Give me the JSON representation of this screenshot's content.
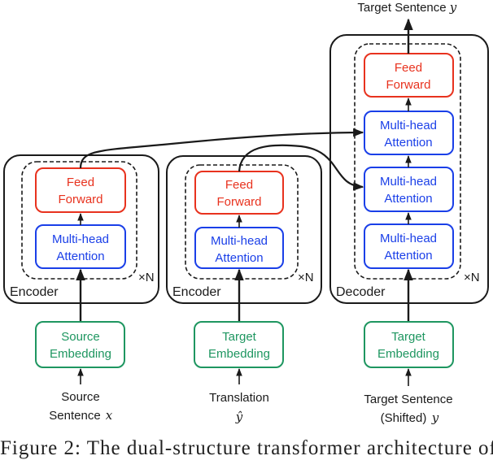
{
  "colors": {
    "feed_forward": "#e8321e",
    "attention": "#1a3fe8",
    "embedding": "#1e9660",
    "line": "#1a1a1a"
  },
  "top_output": {
    "text": "Target Sentence",
    "var": "y"
  },
  "repeat_label": "×N",
  "encoder1": {
    "title": "Encoder",
    "feed_forward": [
      "Feed",
      "Forward"
    ],
    "attention": [
      "Multi-head",
      "Attention"
    ],
    "embedding": [
      "Source",
      "Embedding"
    ],
    "input": [
      "Source",
      "Sentence"
    ],
    "input_var": "x"
  },
  "encoder2": {
    "title": "Encoder",
    "feed_forward": [
      "Feed",
      "Forward"
    ],
    "attention": [
      "Multi-head",
      "Attention"
    ],
    "embedding": [
      "Target",
      "Embedding"
    ],
    "input": [
      "Translation"
    ],
    "input_var": "ŷ"
  },
  "decoder": {
    "title": "Decoder",
    "feed_forward": [
      "Feed",
      "Forward"
    ],
    "attention_1": [
      "Multi-head",
      "Attention"
    ],
    "attention_2": [
      "Multi-head",
      "Attention"
    ],
    "attention_3": [
      "Multi-head",
      "Attention"
    ],
    "embedding": [
      "Target",
      "Embedding"
    ],
    "input": [
      "Target Sentence",
      "(Shifted)"
    ],
    "input_var": "y"
  },
  "caption": "Figure 2: The dual-structure transformer architecture of"
}
